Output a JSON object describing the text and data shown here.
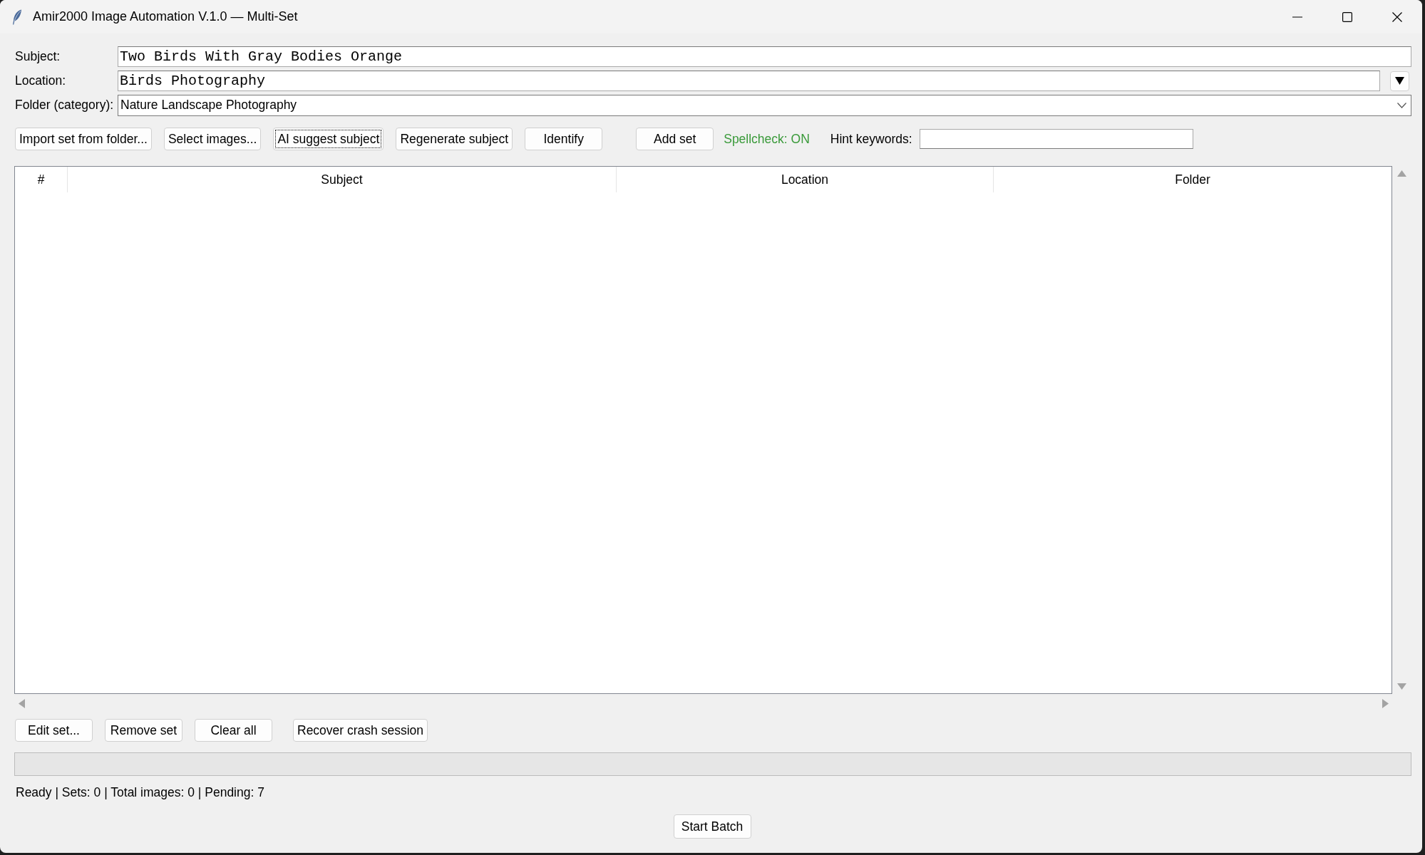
{
  "window": {
    "title": "Amir2000 Image Automation V.1.0 — Multi-Set"
  },
  "form": {
    "fields": [
      {
        "label": "Subject:",
        "kind": "entry",
        "value": "Two Birds With Gray Bodies Orange"
      },
      {
        "label": "Location:",
        "kind": "dropdown_entry",
        "value": "Birds Photography"
      },
      {
        "label": "Folder (category):",
        "kind": "combobox",
        "value": "Nature Landscape Photography"
      }
    ]
  },
  "toolbar": {
    "buttons": [
      {
        "label": "Import set from folder...",
        "focused": false
      },
      {
        "label": "Select images...",
        "focused": false
      },
      {
        "label": "AI suggest subject",
        "focused": true
      },
      {
        "label": "Regenerate subject",
        "focused": false
      },
      {
        "label": "Identify",
        "focused": false
      },
      {
        "label": "Add set",
        "focused": false
      }
    ],
    "spellcheck": "Spellcheck: ON",
    "hint_keywords": {
      "label": "Hint keywords:"
    }
  },
  "table": {
    "columns": [
      "#",
      "Subject",
      "Location",
      "Folder"
    ]
  },
  "actions": [
    "Edit set...",
    "Remove set",
    "Clear all",
    "Recover crash session"
  ],
  "progress": {
    "level": 0
  },
  "status_bar": "Ready | Sets: 0 | Total images: 0 | Pending: 7",
  "start_button": "Start Batch"
}
